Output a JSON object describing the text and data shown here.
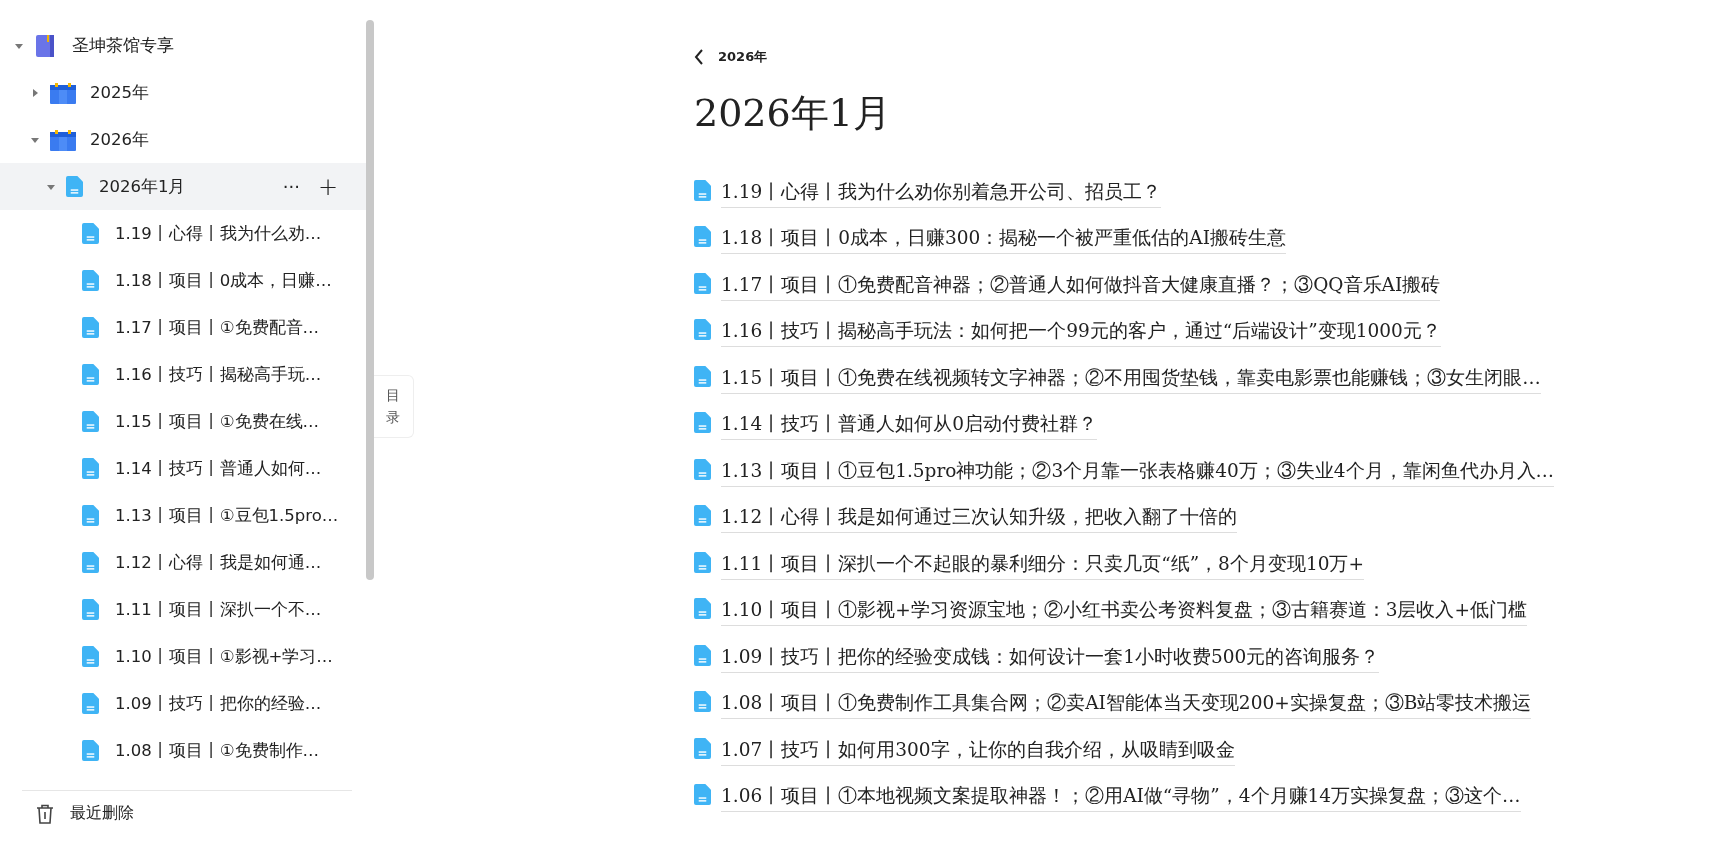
{
  "sidebar": {
    "tree": [
      {
        "label": "圣坤茶馆专享",
        "kind": "notebook",
        "expanded": true,
        "selected": false,
        "children": [
          {
            "label": "2025年",
            "kind": "calendar",
            "expanded": false,
            "selected": false
          },
          {
            "label": "2026年",
            "kind": "calendar",
            "expanded": true,
            "selected": false,
            "children": [
              {
                "label": "2026年1月",
                "kind": "doc",
                "expanded": true,
                "selected": true,
                "children": [
                  {
                    "label": "1.19丨心得丨我为什么劝…",
                    "kind": "doc",
                    "selected": false
                  },
                  {
                    "label": "1.18丨项目丨0成本，日赚…",
                    "kind": "doc",
                    "selected": false
                  },
                  {
                    "label": "1.17丨项目丨①免费配音…",
                    "kind": "doc",
                    "selected": false
                  },
                  {
                    "label": "1.16丨技巧丨揭秘高手玩…",
                    "kind": "doc",
                    "selected": false
                  },
                  {
                    "label": "1.15丨项目丨①免费在线…",
                    "kind": "doc",
                    "selected": false
                  },
                  {
                    "label": "1.14丨技巧丨普通人如何…",
                    "kind": "doc",
                    "selected": false
                  },
                  {
                    "label": "1.13丨项目丨①豆包1.5pro…",
                    "kind": "doc",
                    "selected": false
                  },
                  {
                    "label": "1.12丨心得丨我是如何通…",
                    "kind": "doc",
                    "selected": false
                  },
                  {
                    "label": "1.11丨项目丨深扒一个不…",
                    "kind": "doc",
                    "selected": false
                  },
                  {
                    "label": "1.10丨项目丨①影视+学习…",
                    "kind": "doc",
                    "selected": false
                  },
                  {
                    "label": "1.09丨技巧丨把你的经验…",
                    "kind": "doc",
                    "selected": false
                  },
                  {
                    "label": "1.08丨项目丨①免费制作…",
                    "kind": "doc",
                    "selected": false
                  }
                ]
              }
            ]
          }
        ]
      }
    ],
    "more_button": "···",
    "add_button": "+",
    "recently_deleted": "最近删除"
  },
  "toc_tab": "目录",
  "breadcrumb": "2026年",
  "title": "2026年1月",
  "links": [
    "1.19丨心得丨我为什么劝你别着急开公司、招员工？",
    "1.18丨项目丨0成本，日赚300：揭秘一个被严重低估的AI搬砖生意",
    "1.17丨项目丨①免费配音神器；②普通人如何做抖音大健康直播？；③QQ音乐AI搬砖",
    "1.16丨技巧丨揭秘高手玩法：如何把一个99元的客户，通过“后端设计”变现1000元？",
    "1.15丨项目丨①免费在线视频转文字神器；②不用囤货垫钱，靠卖电影票也能赚钱；③女生闭眼…",
    "1.14丨技巧丨普通人如何从0启动付费社群？",
    "1.13丨项目丨①豆包1.5pro神功能；②3个月靠一张表格赚40万；③失业4个月，靠闲鱼代办月入…",
    "1.12丨心得丨我是如何通过三次认知升级，把收入翻了十倍的",
    "1.11丨项目丨深扒一个不起眼的暴利细分：只卖几页“纸”，8个月变现10万+",
    "1.10丨项目丨①影视+学习资源宝地；②小红书卖公考资料复盘；③古籍赛道：3层收入+低门槛",
    "1.09丨技巧丨把你的经验变成钱：如何设计一套1小时收费500元的咨询服务？",
    "1.08丨项目丨①免费制作工具集合网；②卖AI智能体当天变现200+实操复盘；③B站零技术搬运",
    "1.07丨技巧丨如何用300字，让你的自我介绍，从吸睛到吸金",
    "1.06丨项目丨①本地视频文案提取神器！；②用AI做“寻物”，4个月赚14万实操复盘；③这个…"
  ]
}
